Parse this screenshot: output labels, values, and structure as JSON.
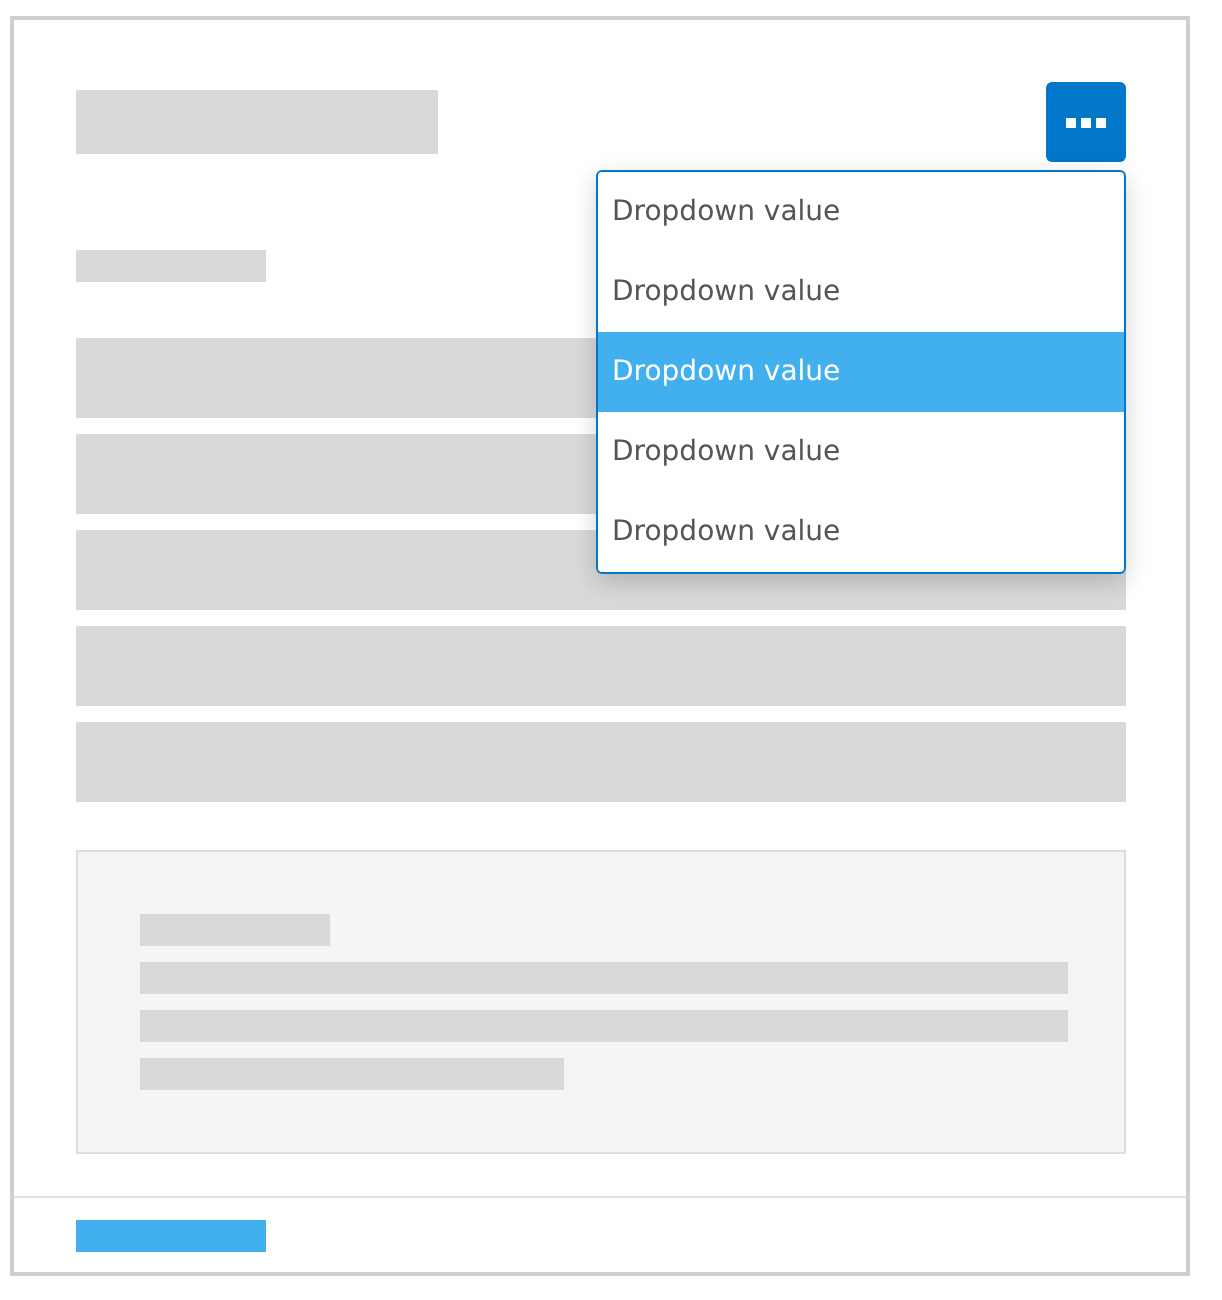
{
  "menu_button": {
    "expanded": true
  },
  "dropdown": {
    "items": [
      {
        "label": "Dropdown value",
        "selected": false
      },
      {
        "label": "Dropdown value",
        "selected": false
      },
      {
        "label": "Dropdown value",
        "selected": true
      },
      {
        "label": "Dropdown value",
        "selected": false
      },
      {
        "label": "Dropdown value",
        "selected": false
      }
    ]
  }
}
